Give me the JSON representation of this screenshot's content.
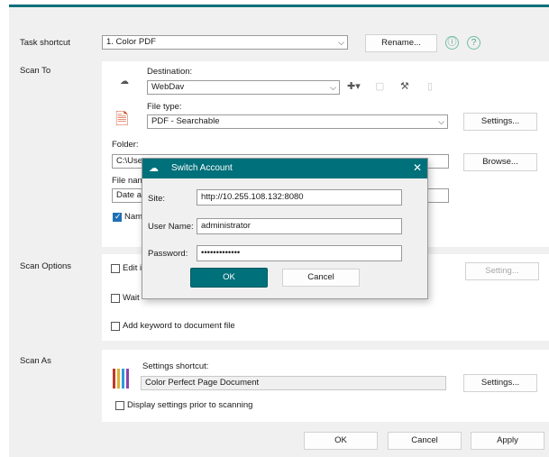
{
  "task_shortcut": {
    "label": "Task shortcut",
    "value": "1. Color PDF",
    "rename_label": "Rename...",
    "info_icon": "ⓘ",
    "help_icon": "?"
  },
  "scan_to": {
    "section_label": "Scan To",
    "destination_label": "Destination:",
    "destination_value": "WebDav",
    "file_type_label": "File type:",
    "file_type_value": "PDF - Searchable",
    "file_type_settings_label": "Settings...",
    "folder_label": "Folder:",
    "folder_value": "C:\\Use",
    "browse_label": "Browse...",
    "file_name_label": "File nan",
    "file_name_value": "Date a",
    "name_checkbox_label": "Nam"
  },
  "scan_options": {
    "section_label": "Scan Options",
    "edit_label": "Edit i",
    "wait_label": "Wait",
    "keyword_label": "Add keyword to document file",
    "setting_label": "Setting..."
  },
  "scan_as": {
    "section_label": "Scan As",
    "settings_shortcut_label": "Settings shortcut:",
    "settings_shortcut_value": "Color Perfect Page Document",
    "settings_label": "Settings...",
    "display_settings_label": "Display settings prior to scanning"
  },
  "footer": {
    "ok_label": "OK",
    "cancel_label": "Cancel",
    "apply_label": "Apply"
  },
  "dialog": {
    "title": "Switch Account",
    "close_glyph": "✕",
    "site_label": "Site:",
    "site_value": "http://10.255.108.132:8080",
    "username_label": "User Name:",
    "username_value": "administrator",
    "password_label": "Password:",
    "password_value": "•••••••••••••",
    "ok_label": "OK",
    "cancel_label": "Cancel"
  },
  "colors": {
    "accent": "#00707a",
    "panel": "#ffffff",
    "background": "#f0f0f0"
  }
}
